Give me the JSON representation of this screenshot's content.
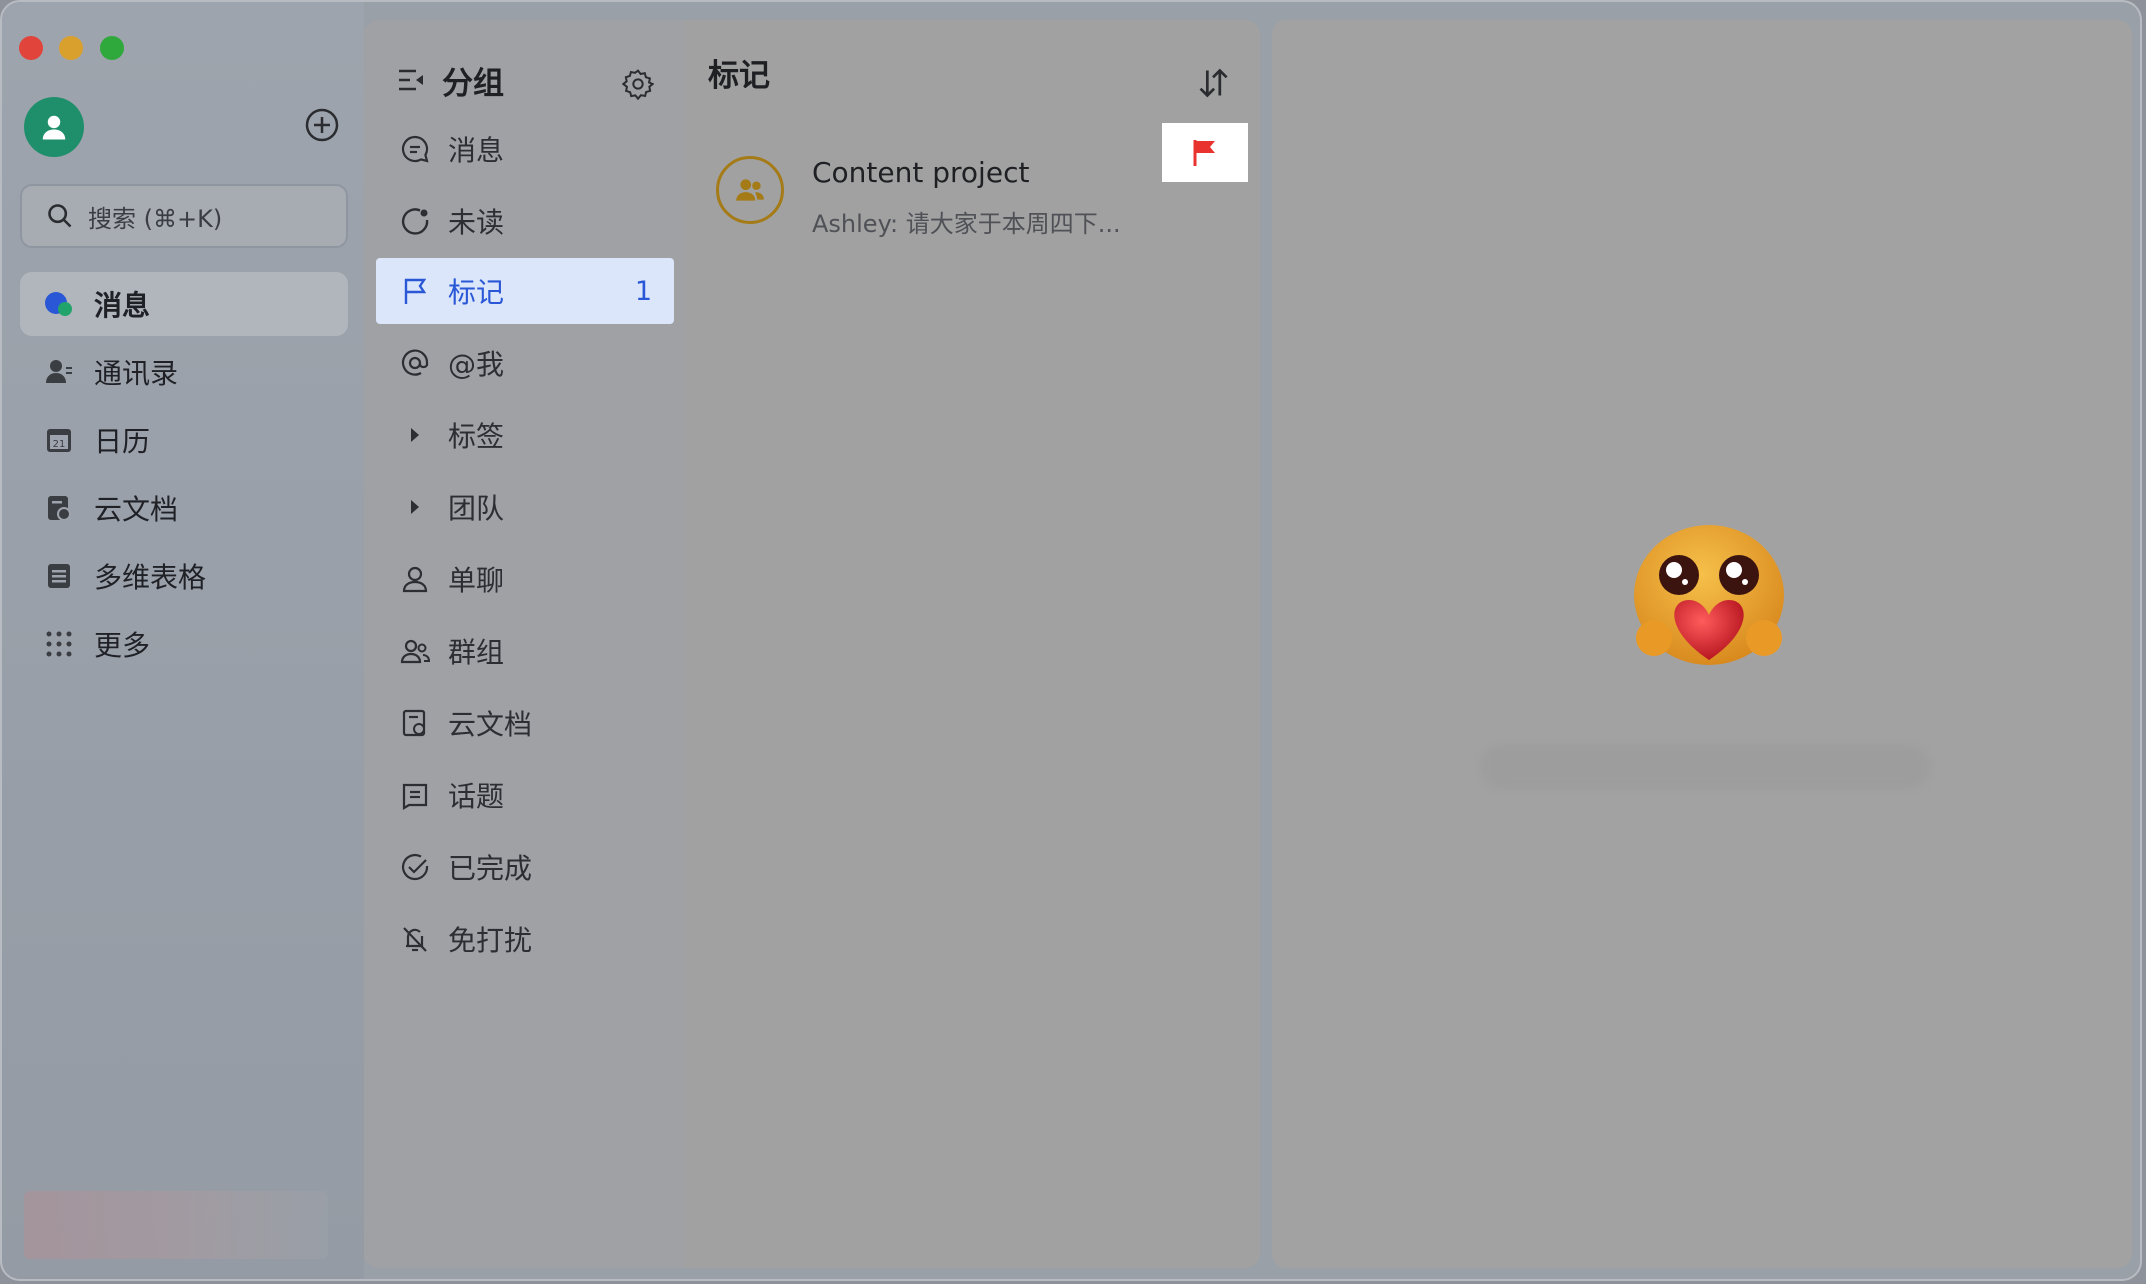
{
  "sidebar": {
    "search": {
      "placeholder": "搜索 (⌘+K)"
    },
    "items": [
      {
        "label": "消息",
        "icon": "message-icon",
        "active": true
      },
      {
        "label": "通讯录",
        "icon": "contacts-icon",
        "active": false
      },
      {
        "label": "日历",
        "icon": "calendar-icon",
        "active": false
      },
      {
        "label": "云文档",
        "icon": "docs-icon",
        "active": false
      },
      {
        "label": "多维表格",
        "icon": "base-icon",
        "active": false
      },
      {
        "label": "更多",
        "icon": "more-grid-icon",
        "active": false
      }
    ]
  },
  "groups": {
    "title": "分组",
    "items": [
      {
        "label": "消息",
        "icon": "message-bubble-icon"
      },
      {
        "label": "未读",
        "icon": "unread-icon"
      },
      {
        "label": "标记",
        "icon": "flag-outline-icon",
        "count": "1",
        "active": true
      },
      {
        "label": "@我",
        "icon": "at-icon"
      },
      {
        "label": "标签",
        "icon": "caret-right-icon"
      },
      {
        "label": "团队",
        "icon": "caret-right-icon"
      },
      {
        "label": "单聊",
        "icon": "single-user-icon"
      },
      {
        "label": "群组",
        "icon": "group-icon"
      },
      {
        "label": "云文档",
        "icon": "doc-icon"
      },
      {
        "label": "话题",
        "icon": "topic-icon"
      },
      {
        "label": "已完成",
        "icon": "done-icon"
      },
      {
        "label": "免打扰",
        "icon": "mute-bell-icon"
      }
    ]
  },
  "list": {
    "title": "标记",
    "chats": [
      {
        "name": "Content project",
        "preview": "Ashley: 请大家于本周四下..."
      }
    ]
  },
  "colors": {
    "accent": "#2a57d6",
    "flag": "#e8332f",
    "avatar": "#1f8f6b"
  }
}
